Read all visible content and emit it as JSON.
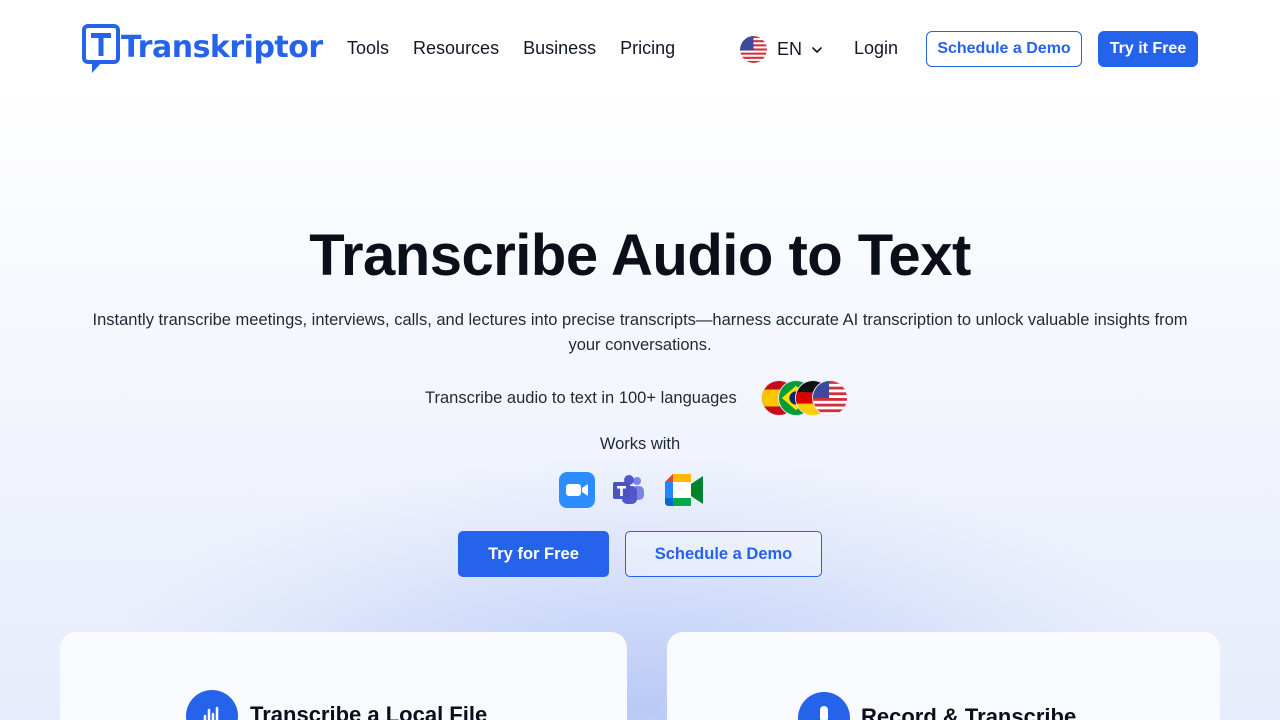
{
  "brand": {
    "name": "Transkriptor",
    "accent": "#2563eb"
  },
  "nav": {
    "items": [
      {
        "label": "Tools"
      },
      {
        "label": "Resources"
      },
      {
        "label": "Business"
      },
      {
        "label": "Pricing"
      }
    ],
    "language": {
      "label": "EN",
      "icon": "us-flag-icon"
    },
    "login": "Login",
    "schedule_demo": "Schedule a Demo",
    "try_free": "Try it Free"
  },
  "hero": {
    "title": "Transcribe Audio to Text",
    "subtitle": "Instantly transcribe meetings, interviews, calls, and lectures into precise transcripts—harness accurate AI transcription to unlock valuable insights from your conversations.",
    "languages_text": "Transcribe audio to text in 100+ languages",
    "language_flags": [
      "spain-flag-icon",
      "brazil-flag-icon",
      "germany-flag-icon",
      "us-flag-icon"
    ],
    "works_with": "Works with",
    "integrations": [
      "zoom-icon",
      "microsoft-teams-icon",
      "google-meet-icon"
    ],
    "cta_primary": "Try for Free",
    "cta_secondary": "Schedule a Demo"
  },
  "cards": [
    {
      "title": "Transcribe a Local File",
      "icon": "waveform-icon"
    },
    {
      "title": "Record & Transcribe",
      "icon": "microphone-icon"
    }
  ]
}
